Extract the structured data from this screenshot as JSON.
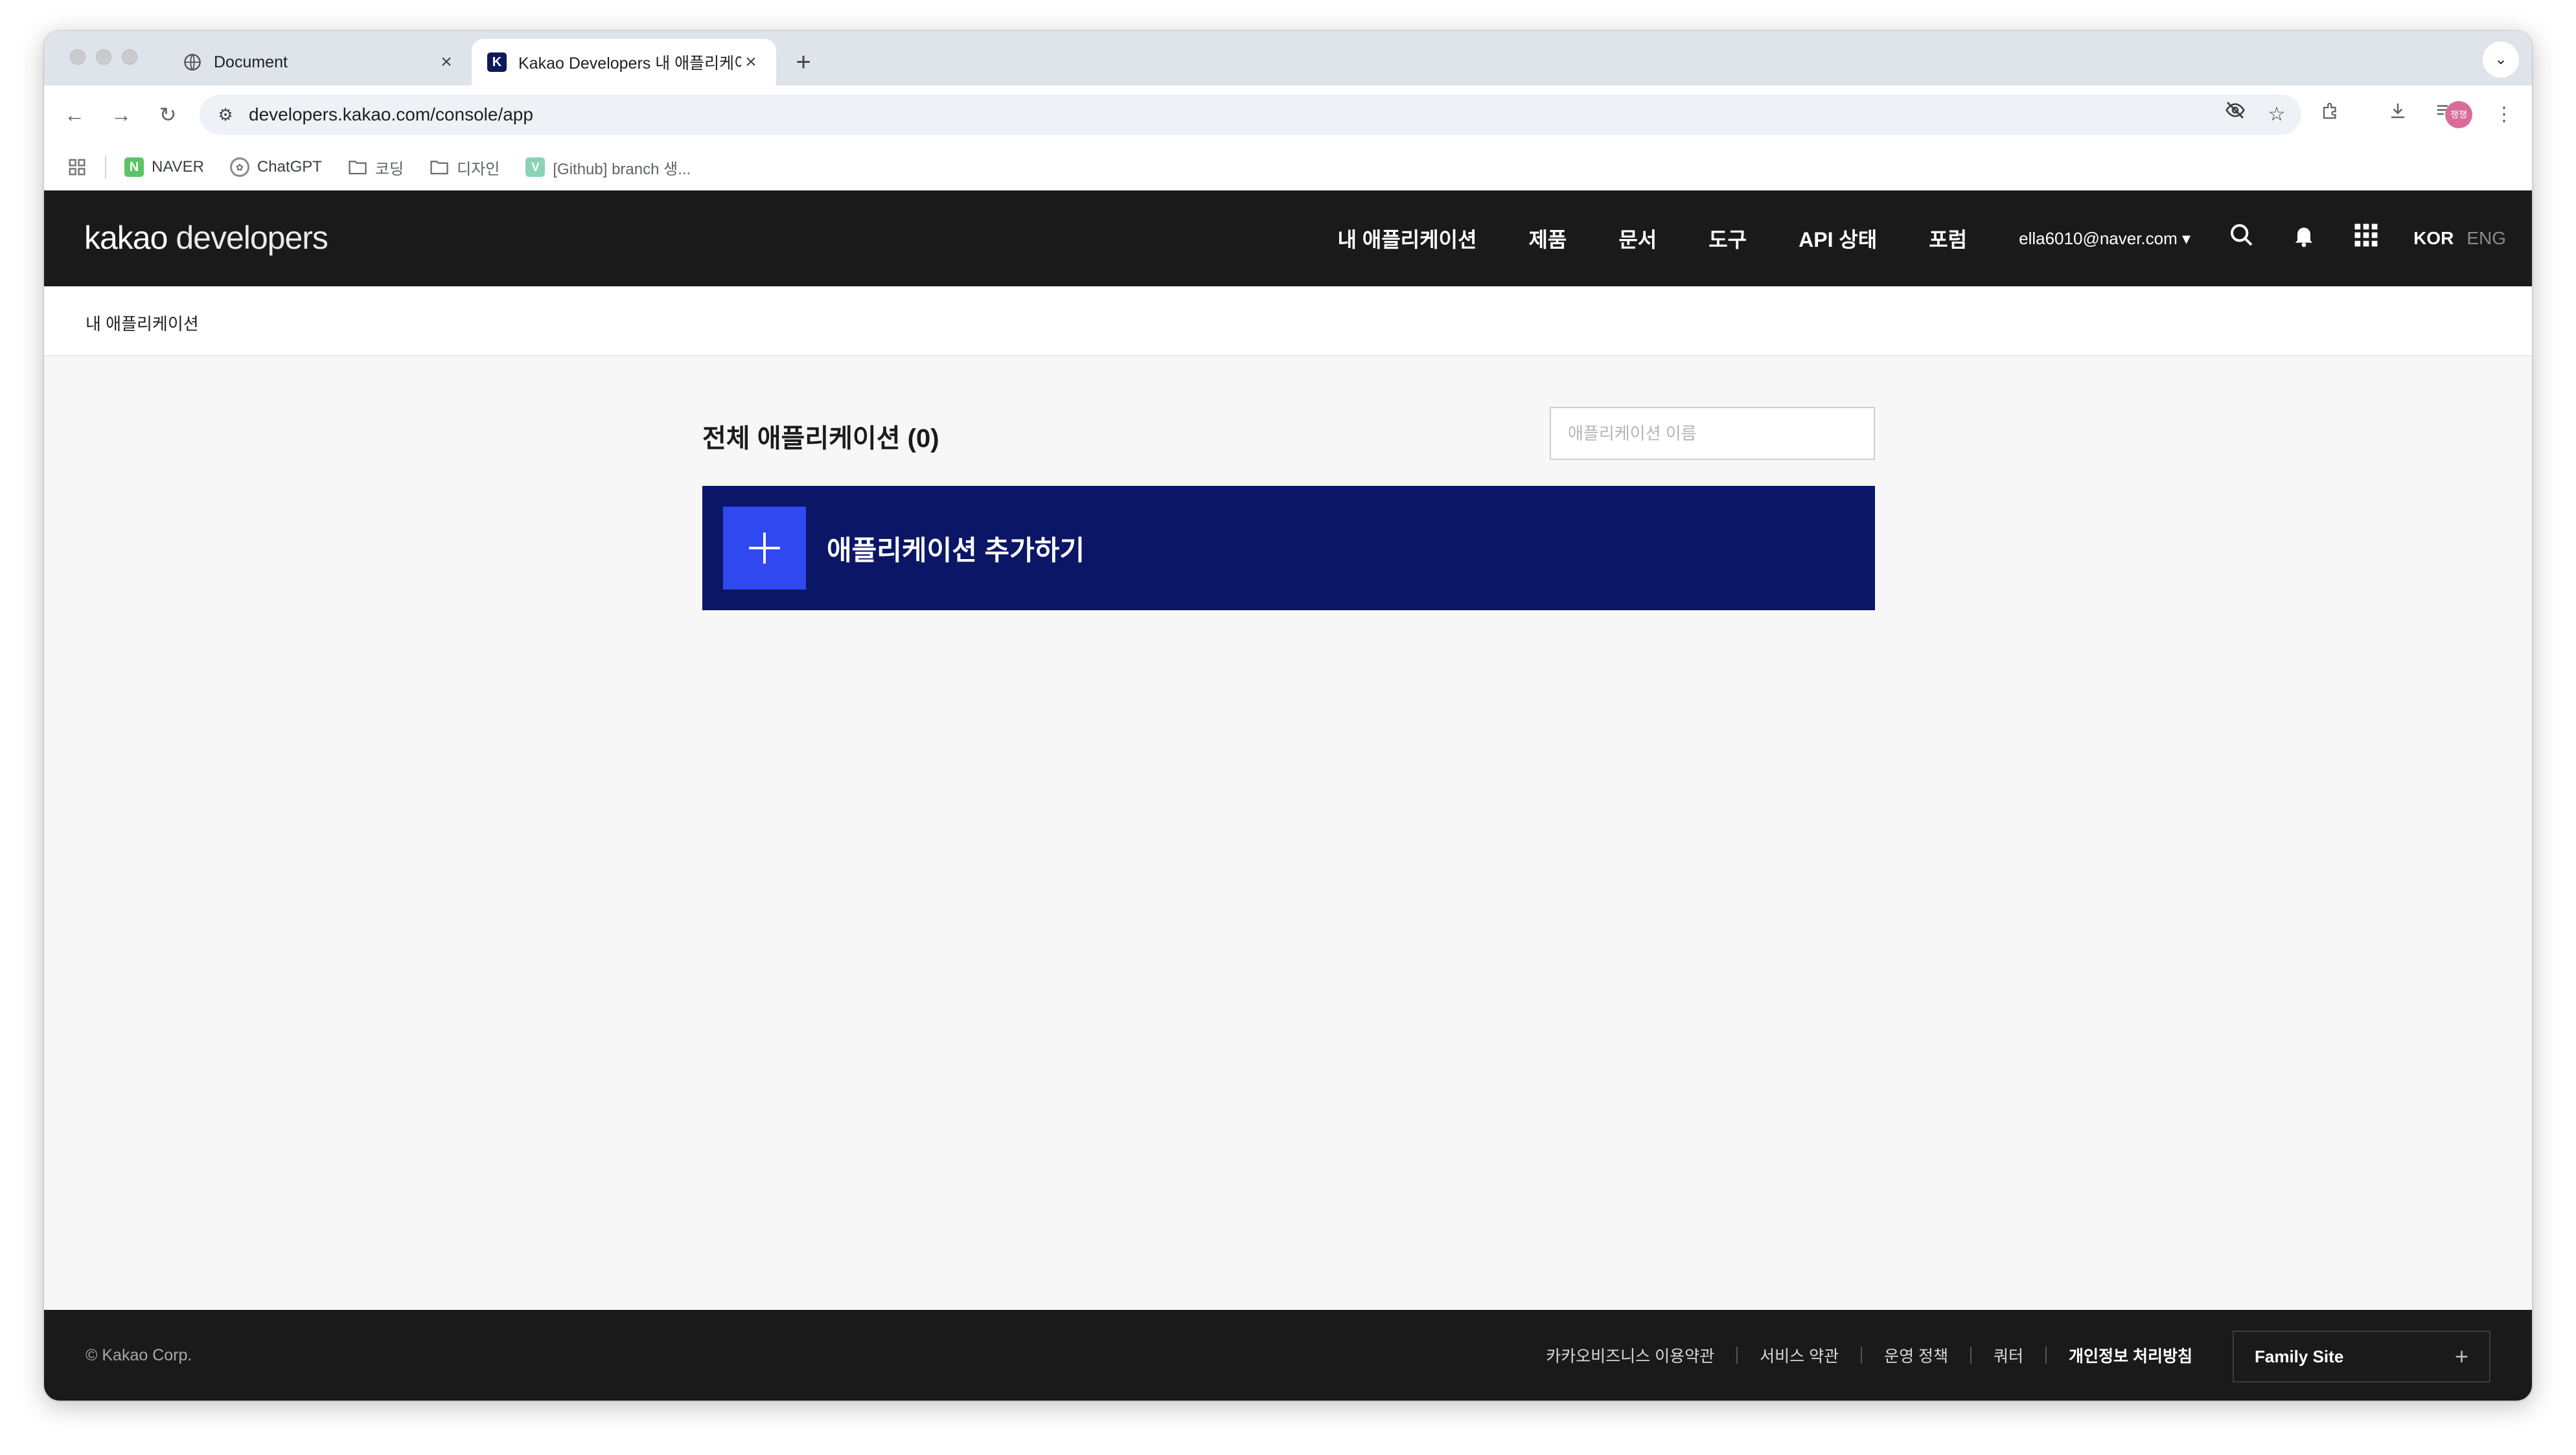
{
  "browser": {
    "tabs": [
      {
        "title": "Document",
        "favicon": "globe-icon"
      },
      {
        "title": "Kakao Developers 내 애플리케이션",
        "favicon": "K",
        "active": true
      }
    ],
    "url": "developers.kakao.com/console/app",
    "bookmarks": [
      {
        "label": "NAVER",
        "icon": "N"
      },
      {
        "label": "ChatGPT",
        "icon": "chatgpt-icon"
      },
      {
        "label": "코딩",
        "icon": "folder-icon"
      },
      {
        "label": "디자인",
        "icon": "folder-icon"
      },
      {
        "label": "[Github] branch 생...",
        "icon": "V"
      }
    ],
    "avatar_text": "쟁쟁"
  },
  "header": {
    "logo_bold": "kakao",
    "logo_light": " developers",
    "nav": [
      "내 애플리케이션",
      "제품",
      "문서",
      "도구",
      "API 상태",
      "포럼"
    ],
    "user_email": "ella6010@naver.com",
    "lang_active": "KOR",
    "lang_inactive": "ENG"
  },
  "breadcrumb": "내 애플리케이션",
  "main": {
    "title": "전체 애플리케이션 (0)",
    "search_placeholder": "애플리케이션 이름",
    "add_button_label": "애플리케이션 추가하기"
  },
  "footer": {
    "copyright": "© Kakao Corp.",
    "links": [
      "카카오비즈니스 이용약관",
      "서비스 약관",
      "운영 정책",
      "쿼터",
      "개인정보 처리방침"
    ],
    "family_site": "Family Site"
  },
  "colors": {
    "header_bg": "#1a1a1a",
    "add_button_bg": "#0b1666",
    "add_button_accent": "#3048f0"
  }
}
